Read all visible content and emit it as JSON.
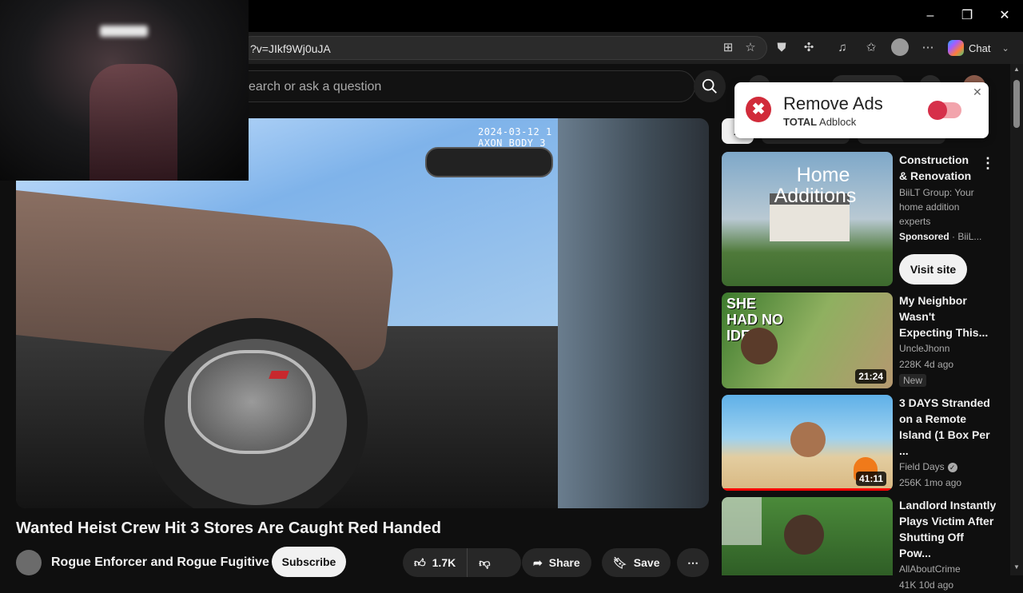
{
  "browser": {
    "url": "?v=JIkf9Wj0uJA",
    "chat_label": "Chat",
    "win_controls": {
      "minimize": "–",
      "restore": "❐",
      "close": "✕"
    }
  },
  "youtube": {
    "search_placeholder": "earch or ask a question",
    "filter_chip_active": "A"
  },
  "video": {
    "timestamp_line1": "2024-03-12 1",
    "timestamp_line2": "AXON BODY 3",
    "title": "Wanted Heist Crew Hit 3 Stores Are Caught Red Handed",
    "channel": "Rogue Enforcer and Rogue Fugitive",
    "subscribe_label": "Subscribe",
    "like_count": "1.7K",
    "share_label": "Share",
    "save_label": "Save"
  },
  "ad_popup": {
    "title": "Remove Ads",
    "brand_bold": "TOTAL",
    "brand_rest": " Adblock"
  },
  "sidebar": {
    "sponsored": {
      "thumb_text_1": "Home",
      "thumb_text_2": "Additions",
      "title": "Construction & Renovation",
      "description": "BiiLT Group: Your home addition experts",
      "sponsored_label": "Sponsored",
      "advertiser": "BiiL...",
      "visit_label": "Visit site"
    },
    "videos": [
      {
        "thumb_text": "SHE HAD NO IDEA.",
        "duration": "21:24",
        "title": "My Neighbor Wasn't Expecting This...",
        "channel": "UncleJhonn",
        "stats": "228K  4d ago",
        "badge": "New",
        "verified": false
      },
      {
        "thumb_text": "",
        "duration": "41:11",
        "title": "3 DAYS Stranded on a Remote Island (1 Box Per ...",
        "channel": "Field Days",
        "stats": "256K  1mo ago",
        "badge": "",
        "verified": true
      },
      {
        "thumb_text": "",
        "duration": "",
        "title": "Landlord Instantly Plays Victim After Shutting Off Pow...",
        "channel": "AllAboutCrime",
        "stats": "41K  10d ago",
        "badge": "",
        "verified": false
      }
    ]
  },
  "colors": {
    "background": "#0f0f0f",
    "ad_accent": "#d12b3a",
    "youtube_red": "#ff0000"
  }
}
